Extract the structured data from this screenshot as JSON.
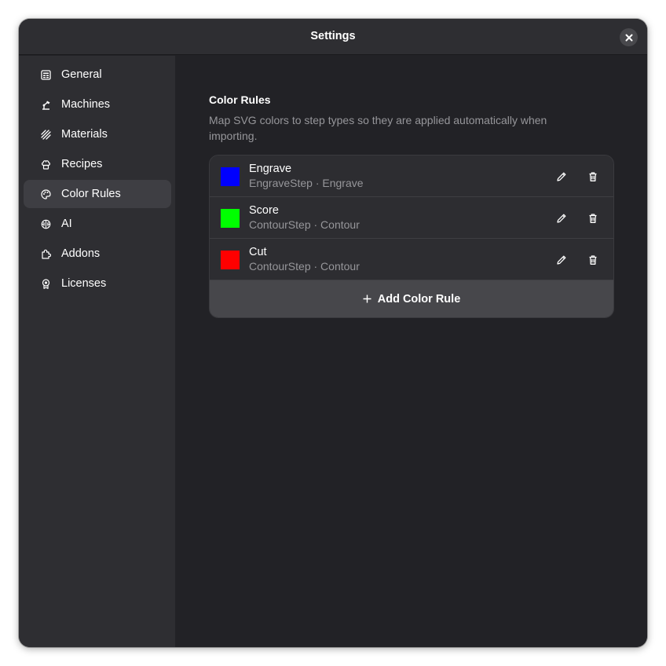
{
  "window": {
    "title": "Settings"
  },
  "sidebar": {
    "items": [
      {
        "label": "General",
        "icon": "general-icon"
      },
      {
        "label": "Machines",
        "icon": "machine-icon"
      },
      {
        "label": "Materials",
        "icon": "materials-icon"
      },
      {
        "label": "Recipes",
        "icon": "recipes-icon"
      },
      {
        "label": "Color Rules",
        "icon": "palette-icon",
        "active": true
      },
      {
        "label": "AI",
        "icon": "ai-icon"
      },
      {
        "label": "Addons",
        "icon": "puzzle-icon"
      },
      {
        "label": "Licenses",
        "icon": "license-icon"
      }
    ]
  },
  "main": {
    "title": "Color Rules",
    "description": "Map SVG colors to step types so they are applied automatically when importing.",
    "rules": [
      {
        "name": "Engrave",
        "subtitle": "EngraveStep · Engrave",
        "color": "#0000ff"
      },
      {
        "name": "Score",
        "subtitle": "ContourStep · Contour",
        "color": "#00ff00"
      },
      {
        "name": "Cut",
        "subtitle": "ContourStep · Contour",
        "color": "#ff0000"
      }
    ],
    "add_label": "Add Color Rule"
  },
  "colors": {
    "window_bg": "#222226",
    "sidebar_bg": "#2e2e32",
    "active_item_bg": "#3e3e43",
    "text_primary": "#ffffff",
    "text_secondary": "#96969a"
  }
}
